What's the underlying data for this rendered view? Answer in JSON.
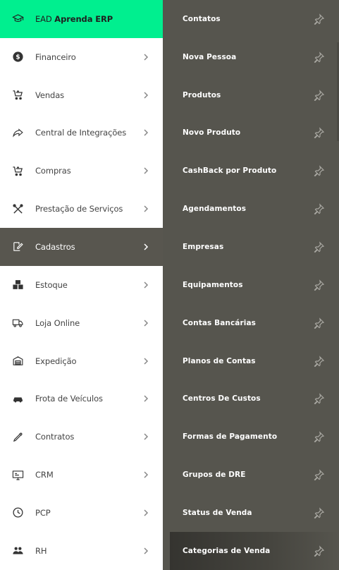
{
  "sidebar": {
    "ead": {
      "prefix": "EAD",
      "name": "Aprenda ERP",
      "icon": "graduation-cap-icon"
    },
    "items": [
      {
        "label": "Financeiro",
        "icon": "dollar-circle-icon"
      },
      {
        "label": "Vendas",
        "icon": "cart-icon"
      },
      {
        "label": "Central de Integrações",
        "icon": "share-arrow-icon"
      },
      {
        "label": "Compras",
        "icon": "cart-icon"
      },
      {
        "label": "Prestação de Serviços",
        "icon": "tools-icon"
      },
      {
        "label": "Cadastros",
        "icon": "edit-icon",
        "active": true
      },
      {
        "label": "Estoque",
        "icon": "boxes-icon"
      },
      {
        "label": "Loja Online",
        "icon": "truck-icon"
      },
      {
        "label": "Expedição",
        "icon": "warehouse-icon"
      },
      {
        "label": "Frota de Veículos",
        "icon": "car-icon"
      },
      {
        "label": "Contratos",
        "icon": "pen-icon"
      },
      {
        "label": "CRM",
        "icon": "monitor-icon"
      },
      {
        "label": "PCP",
        "icon": "clock-icon"
      },
      {
        "label": "RH",
        "icon": "users-icon"
      }
    ]
  },
  "submenu": {
    "items": [
      {
        "label": "Contatos"
      },
      {
        "label": "Nova Pessoa"
      },
      {
        "label": "Produtos"
      },
      {
        "label": "Novo Produto"
      },
      {
        "label": "CashBack por Produto"
      },
      {
        "label": "Agendamentos"
      },
      {
        "label": "Empresas"
      },
      {
        "label": "Equipamentos"
      },
      {
        "label": "Contas Bancárias"
      },
      {
        "label": "Planos de Contas"
      },
      {
        "label": "Centros De Custos"
      },
      {
        "label": "Formas de Pagamento"
      },
      {
        "label": "Grupos de DRE"
      },
      {
        "label": "Status de Venda"
      },
      {
        "label": "Categorias de Venda",
        "highlight": true
      }
    ]
  },
  "colors": {
    "ead_bg": "#00ef8f",
    "active_bg": "#58564f",
    "submenu_bg": "#56554e"
  }
}
